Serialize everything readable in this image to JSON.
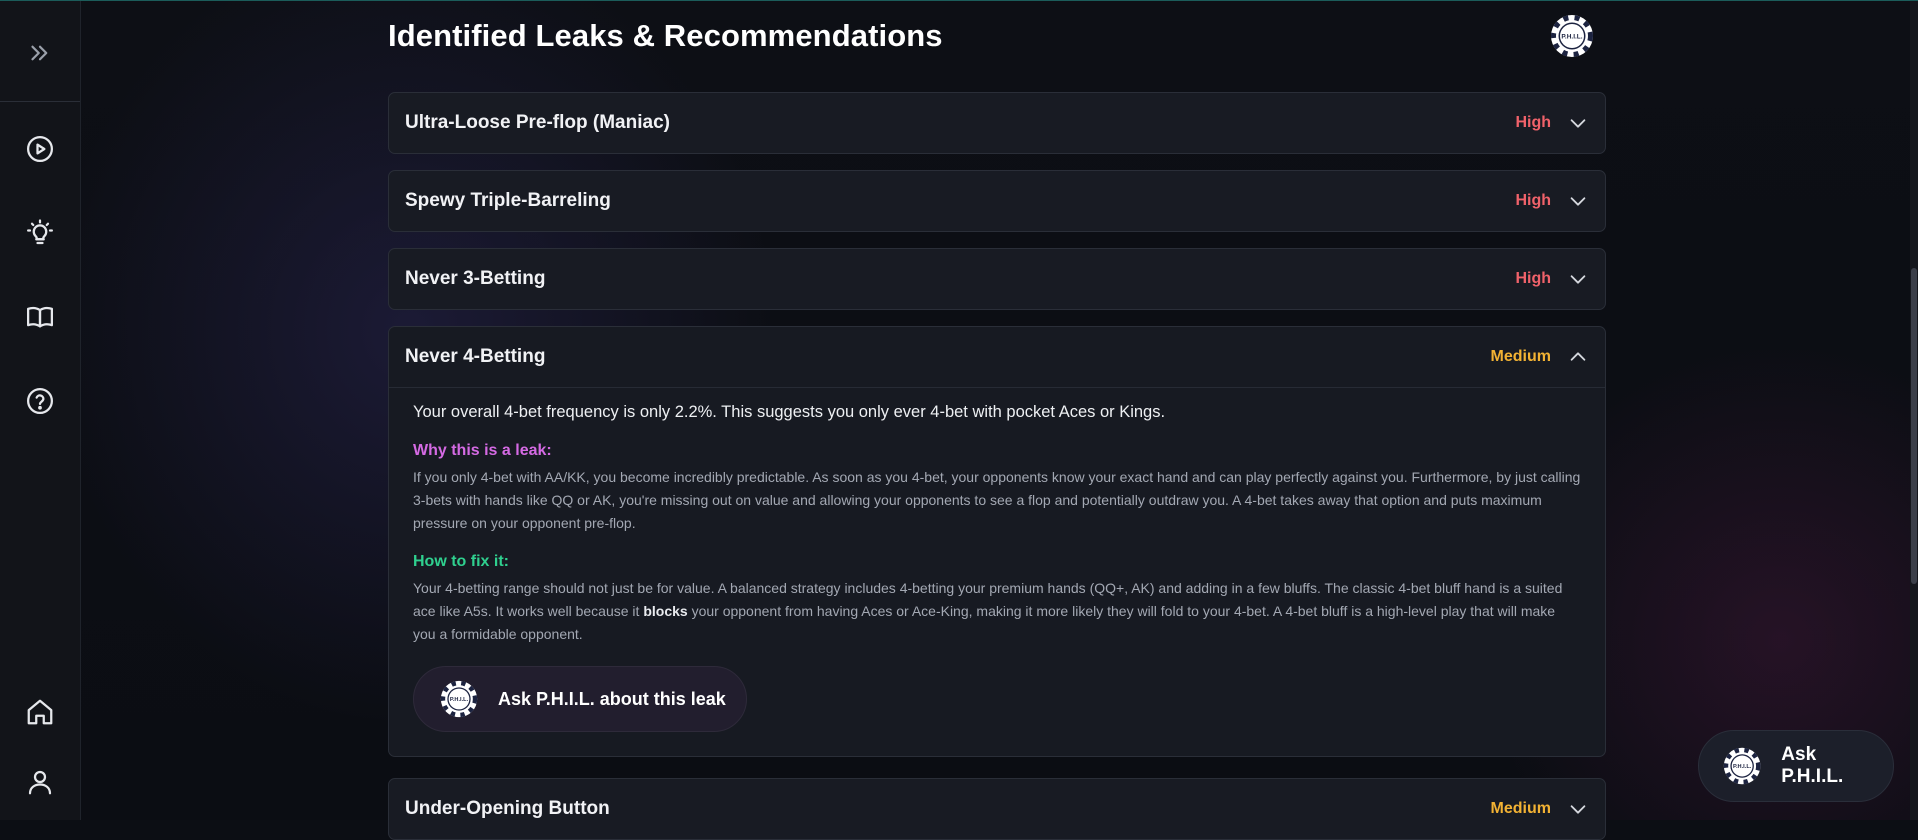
{
  "page": {
    "title": "Identified Leaks & Recommendations"
  },
  "sidebar": {
    "items": [
      {
        "icon": "chevrons-right-icon",
        "name": "expand"
      },
      {
        "icon": "play-circle-icon",
        "name": "play"
      },
      {
        "icon": "lightbulb-icon",
        "name": "insights"
      },
      {
        "icon": "book-icon",
        "name": "learn"
      },
      {
        "icon": "help-circle-icon",
        "name": "help"
      },
      {
        "icon": "home-icon",
        "name": "home"
      },
      {
        "icon": "user-icon",
        "name": "profile"
      }
    ]
  },
  "colors": {
    "high": "#f0626a",
    "medium": "#f2b233",
    "why_heading": "#d56ae4",
    "fix_heading": "#2fd08f",
    "background": "#0c0e14",
    "card": "#181b23"
  },
  "leaks": [
    {
      "title": "Ultra-Loose Pre-flop (Maniac)",
      "severity": "High",
      "expanded": false
    },
    {
      "title": "Spewy Triple-Barreling",
      "severity": "High",
      "expanded": false
    },
    {
      "title": "Never 3-Betting",
      "severity": "High",
      "expanded": false
    },
    {
      "title": "Never 4-Betting",
      "severity": "Medium",
      "expanded": true,
      "summary": "Your overall 4-bet frequency is only 2.2%. This suggests you only ever 4-bet with pocket Aces or Kings.",
      "why_heading": "Why this is a leak:",
      "why_text": "If you only 4-bet with AA/KK, you become incredibly predictable. As soon as you 4-bet, your opponents know your exact hand and can play perfectly against you. Furthermore, by just calling 3-bets with hands like QQ or AK, you're missing out on value and allowing your opponents to see a flop and potentially outdraw you. A 4-bet takes away that option and puts maximum pressure on your opponent pre-flop.",
      "fix_heading": "How to fix it:",
      "fix_text_before": "Your 4-betting range should not just be for value. A balanced strategy includes 4-betting your premium hands (QQ+, AK) and adding in a few bluffs. The classic 4-bet bluff hand is a suited ace like A5s. It works well because it ",
      "fix_text_bold": "blocks",
      "fix_text_after": " your opponent from having Aces or Ace-King, making it more likely they will fold to your 4-bet. A 4-bet bluff is a high-level play that will make you a formidable opponent.",
      "ask_label": "Ask P.H.I.L. about this leak"
    },
    {
      "title": "Under-Opening Button",
      "severity": "Medium",
      "expanded": false
    }
  ],
  "assistant": {
    "fab_label": "Ask P.H.I.L.",
    "chip_text": "P.H.I.L."
  }
}
